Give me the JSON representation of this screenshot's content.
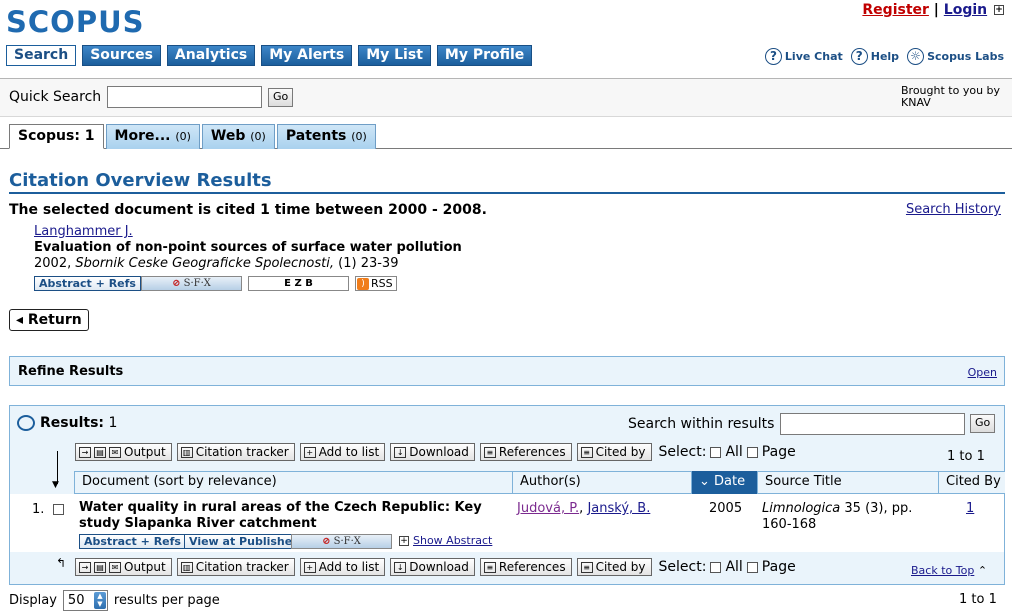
{
  "logo": "SCOPUS",
  "header": {
    "register": "Register",
    "separator": "|",
    "login": "Login"
  },
  "nav": [
    "Search",
    "Sources",
    "Analytics",
    "My Alerts",
    "My List",
    "My Profile"
  ],
  "help": {
    "live_chat": "Live Chat",
    "help": "Help",
    "labs": "Scopus Labs"
  },
  "quick_search": {
    "label": "Quick Search",
    "value": "",
    "go": "Go",
    "brought_by": "Brought to you by KNAV"
  },
  "result_tabs": [
    {
      "label": "Scopus: 1",
      "count": ""
    },
    {
      "label": "More...",
      "count": "(0)"
    },
    {
      "label": "Web",
      "count": "(0)"
    },
    {
      "label": "Patents",
      "count": "(0)"
    }
  ],
  "page": {
    "title": "Citation Overview Results",
    "cited_text": "The selected document is cited 1 time between 2000 - 2008.",
    "search_history": "Search History"
  },
  "document": {
    "author": "Langhammer J.",
    "title": "Evaluation of non-point sources of surface water pollution",
    "year": "2002,",
    "journal": "Sbornik Ceske Geograficke Spolecnosti,",
    "issue": "(1) 23-39",
    "abstract_refs": "Abstract + Refs",
    "sfx": "S·F·X",
    "ezb": "E Z B",
    "rss": "RSS"
  },
  "return_label": "Return",
  "refine": {
    "label": "Refine Results",
    "open": "Open"
  },
  "results": {
    "label": "Results:",
    "count": "1",
    "search_within": "Search within results",
    "search_value": "",
    "go": "Go",
    "paging": "1 to 1",
    "toolbar": {
      "output": "Output",
      "citation_tracker": "Citation tracker",
      "add_to_list": "Add to list",
      "download": "Download",
      "references": "References",
      "cited_by": "Cited by",
      "select": "Select:",
      "all": "All",
      "page": "Page"
    },
    "columns": {
      "document": "Document (sort by relevance)",
      "authors": "Author(s)",
      "date": "Date",
      "source": "Source Title",
      "cited_by": "Cited By"
    },
    "rows": [
      {
        "num": "1.",
        "title": "Water quality in rural areas of the Czech Republic: Key study Slapanka River catchment",
        "author1": "Judová, P.",
        "comma": ",",
        "author2": "Janský, B.",
        "date": "2005",
        "source_journal": "Limnologica",
        "source_rest": "35 (3), pp. 160-168",
        "cited_by": "1",
        "abstract_refs": "Abstract + Refs",
        "view_publisher": "View at Publisher",
        "sfx": "S·F·X",
        "show_abstract": "Show Abstract"
      }
    ],
    "back_to_top": "Back to Top"
  },
  "footer": {
    "display": "Display",
    "per_page_value": "50",
    "results_per_page": "results per page",
    "paging": "1 to 1"
  }
}
